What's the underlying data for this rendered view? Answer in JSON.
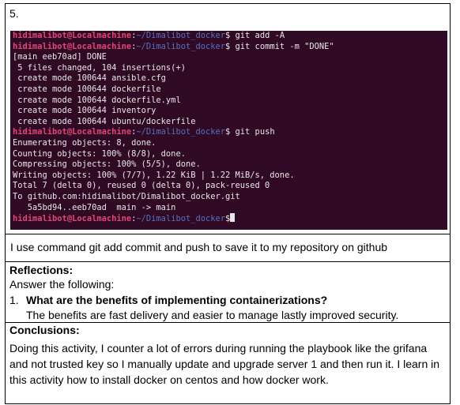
{
  "item_number": "5.",
  "terminal": {
    "prompt_user": "hidimalibot@Localmachine",
    "prompt_sep": ":",
    "prompt_path": "~/Dimalibot_docker",
    "prompt_dollar": "$",
    "cmd_add": " git add -A",
    "cmd_commit": " git commit -m \"DONE\"",
    "commit_output": [
      "[main eeb70ad] DONE",
      " 5 files changed, 104 insertions(+)",
      " create mode 100644 ansible.cfg",
      " create mode 100644 dockerfile",
      " create mode 100644 dockerfile.yml",
      " create mode 100644 inventory",
      " create mode 100644 ubuntu/dockerfile"
    ],
    "cmd_push": " git push",
    "push_output": [
      "Enumerating objects: 8, done.",
      "Counting objects: 100% (8/8), done.",
      "Compressing objects: 100% (5/5), done.",
      "Writing objects: 100% (7/7), 1.22 KiB | 1.22 MiB/s, done.",
      "Total 7 (delta 0), reused 0 (delta 0), pack-reused 0",
      "To github.com:hidimalibot/Dimalibot_docker.git",
      "   5a5bd94..eeb70ad  main -> main"
    ]
  },
  "caption": "I use command git add commit and push to save it to my repository on github",
  "reflections": {
    "heading": "Reflections:",
    "instruction": "Answer the following:",
    "q_number": "1.",
    "question": "What are the benefits of implementing containerizations?",
    "answer": "The benefits are fast delivery and easier to manage lastly improved security."
  },
  "conclusions": {
    "heading": "Conclusions:",
    "text": " Doing this activity, I counter a lot of errors during running the playbook like the grifana and not trusted key so I manually update and upgrade server 1 and then run it. I learn in this activity how to install docker on centos and how docker work."
  }
}
